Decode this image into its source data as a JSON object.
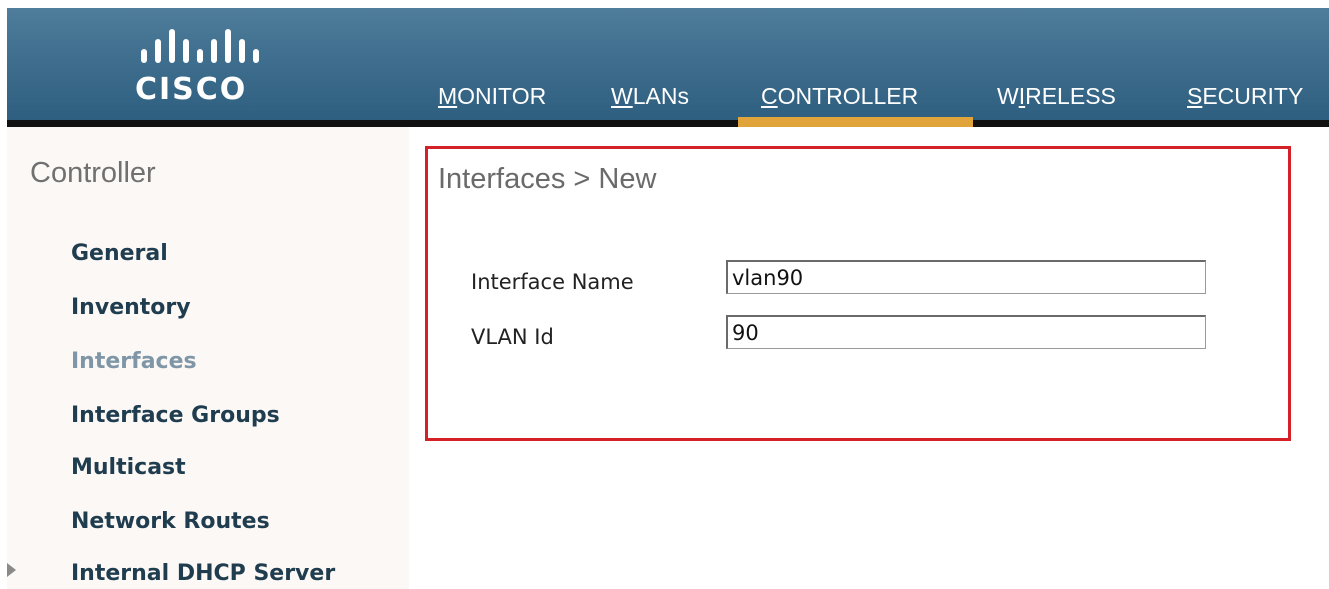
{
  "brand": {
    "logo_text": "CISCO",
    "logo_icon": "cisco-bridge-bars-icon"
  },
  "colors": {
    "header": "#3f6e8e",
    "nav_active_accent": "#e0a43a",
    "sidebar_background": "#fcf8f6",
    "sidebar_item": "#1f3d4f",
    "sidebar_item_selected": "#7e96a6",
    "highlight_box": "#d42128"
  },
  "nav": {
    "items": [
      {
        "pre": "",
        "ul": "M",
        "post": "ONITOR"
      },
      {
        "pre": "",
        "ul": "W",
        "post": "LANs"
      },
      {
        "pre": "",
        "ul": "C",
        "post": "ONTROLLER"
      },
      {
        "pre": "W",
        "ul": "I",
        "post": "RELESS"
      },
      {
        "pre": "",
        "ul": "S",
        "post": "ECURITY"
      }
    ],
    "active": "CONTROLLER"
  },
  "sidebar": {
    "title": "Controller",
    "items": [
      {
        "label": "General"
      },
      {
        "label": "Inventory"
      },
      {
        "label": "Interfaces"
      },
      {
        "label": "Interface Groups"
      },
      {
        "label": "Multicast"
      },
      {
        "label": "Network Routes"
      },
      {
        "label": "Internal DHCP Server"
      }
    ],
    "selected": "Interfaces",
    "expandable_icon": "triangle-right-icon"
  },
  "main": {
    "title": "Interfaces > New",
    "fields": [
      {
        "label": "Interface Name",
        "value": "vlan90"
      },
      {
        "label": "VLAN Id",
        "value": "90"
      }
    ]
  }
}
